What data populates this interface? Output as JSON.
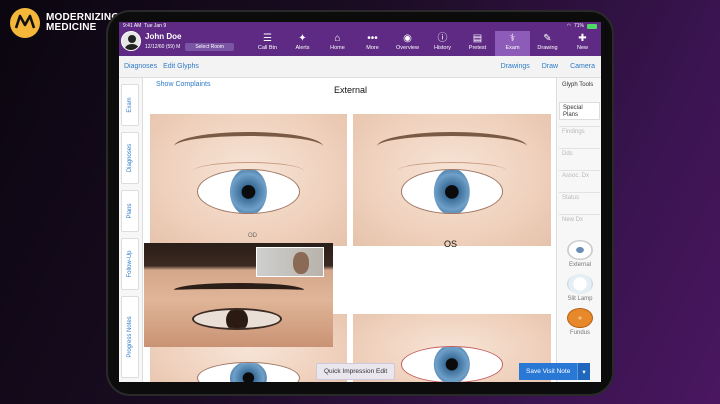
{
  "brand": {
    "line1": "MODERNIZING",
    "line2": "MEDICINE"
  },
  "status_bar": {
    "time": "9:41 AM",
    "date": "Tue Jan 9",
    "battery": "71%"
  },
  "patient": {
    "name": "John Doe",
    "dob": "12/12/60 (59) M",
    "select_room": "Select Room"
  },
  "nav": [
    {
      "label": "Call Btn",
      "icon": "call-button-icon",
      "glyph": "☰"
    },
    {
      "label": "Alerts",
      "icon": "alert-bell-icon",
      "glyph": "✦"
    },
    {
      "label": "Home",
      "icon": "home-icon",
      "glyph": "⌂"
    },
    {
      "label": "More",
      "icon": "more-dots-icon",
      "glyph": "•••"
    },
    {
      "label": "Overview",
      "icon": "overview-person-icon",
      "glyph": "◉"
    },
    {
      "label": "History",
      "icon": "history-info-icon",
      "glyph": "ⓘ"
    },
    {
      "label": "Pretest",
      "icon": "pretest-clipboard-icon",
      "glyph": "▤"
    },
    {
      "label": "Exam",
      "icon": "stethoscope-icon",
      "glyph": "⚕"
    },
    {
      "label": "Drawing",
      "icon": "drawing-pencil-icon",
      "glyph": "✎"
    },
    {
      "label": "New",
      "icon": "new-item-icon",
      "glyph": "✚"
    }
  ],
  "subbar": {
    "diagnoses": "Diagnoses",
    "edit_glyphs": "Edit Glyphs",
    "drawings": "Drawings",
    "draw": "Draw",
    "camera": "Camera"
  },
  "left_tabs": [
    "Exam",
    "Diagnoses",
    "Plans",
    "Follow-Up",
    "Progress Notes"
  ],
  "main": {
    "show_complaints": "Show Complaints",
    "external_title": "External",
    "od_label": "OD",
    "os_label": "OS",
    "quick_impression": "Quick Impression Edit"
  },
  "right_panel": {
    "tabs": [
      "Glyph Tools",
      "Special Plans",
      "Findings",
      "Dds",
      "Assoc. Dx",
      "Status",
      "New Dx"
    ],
    "thumbs": [
      "External",
      "Slit Lamp",
      "Fundus"
    ]
  },
  "save_visit": "Save Visit Note",
  "colors": {
    "nav_purple": "#5e2a84",
    "link_blue": "#2d7bc7",
    "save_blue": "#2a78d6"
  }
}
